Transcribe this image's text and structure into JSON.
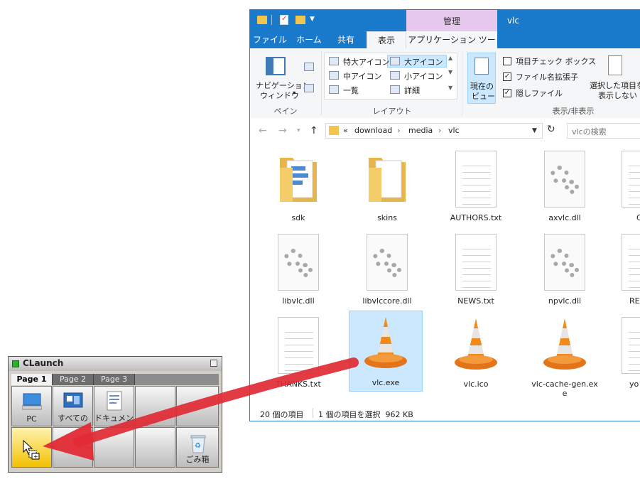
{
  "explorer": {
    "window_title": "vlc",
    "context_tab": "管理",
    "tabs": [
      "ファイル",
      "ホーム",
      "共有",
      "表示",
      "アプリケーション ツール"
    ],
    "active_tab": "表示",
    "ribbon": {
      "pane": {
        "nav_pane_line1": "ナビゲーション",
        "nav_pane_line2": "ウィンドウ",
        "group_label": "ペイン"
      },
      "layout": {
        "items": [
          "特大アイコン",
          "大アイコン",
          "中アイコン",
          "小アイコン",
          "一覧",
          "詳細"
        ],
        "selected": "大アイコン",
        "group_label": "レイアウト"
      },
      "current_view_line1": "現在の",
      "current_view_line2": "ビュー",
      "show_hide": {
        "checkbox_item_check": "項目チェック ボックス",
        "checkbox_extension": "ファイル名拡張子",
        "checkbox_hidden": "隠しファイル",
        "item_check_checked": false,
        "extension_checked": true,
        "hidden_checked": true,
        "hide_selected_line1": "選択した項目を",
        "hide_selected_line2": "表示しない",
        "group_label": "表示/非表示"
      }
    },
    "address": {
      "prefix": "«",
      "segments": [
        "download",
        "media",
        "vlc"
      ]
    },
    "search_placeholder": "vlcの検索",
    "files": [
      {
        "name": "sdk",
        "kind": "folder-docs"
      },
      {
        "name": "skins",
        "kind": "folder"
      },
      {
        "name": "AUTHORS.txt",
        "kind": "text"
      },
      {
        "name": "axvlc.dll",
        "kind": "dll"
      },
      {
        "name": "CO",
        "kind": "text"
      },
      {
        "name": "libvlc.dll",
        "kind": "dll"
      },
      {
        "name": "libvlccore.dll",
        "kind": "dll"
      },
      {
        "name": "NEWS.txt",
        "kind": "text"
      },
      {
        "name": "npvlc.dll",
        "kind": "dll"
      },
      {
        "name": "REA",
        "kind": "text"
      },
      {
        "name": "THANKS.txt",
        "kind": "text"
      },
      {
        "name": "vlc.exe",
        "kind": "cone",
        "selected": true
      },
      {
        "name": "vlc.ico",
        "kind": "cone"
      },
      {
        "name": "vlc-cache-gen.exe",
        "kind": "cone"
      },
      {
        "name": "yo",
        "kind": "text"
      }
    ],
    "status": {
      "item_count": "20 個の項目",
      "selection": "1 個の項目を選択  962 KB"
    }
  },
  "claunch": {
    "title": "CLaunch",
    "tabs": [
      "Page 1",
      "Page 2",
      "Page 3"
    ],
    "active_tab": "Page 1",
    "buttons": [
      {
        "label": "PC",
        "icon": "pc-icon"
      },
      {
        "label": "すべての",
        "icon": "control-panel-icon"
      },
      {
        "label": "ドキュメン",
        "icon": "document-icon"
      },
      {
        "label": "",
        "icon": ""
      },
      {
        "label": "",
        "icon": ""
      },
      {
        "label": "",
        "icon": "drop-target-icon",
        "highlighted": true
      },
      {
        "label": "",
        "icon": ""
      },
      {
        "label": "",
        "icon": ""
      },
      {
        "label": "",
        "icon": ""
      },
      {
        "label": "ごみ箱",
        "icon": "recycle-bin-icon"
      }
    ]
  },
  "colors": {
    "title_bar": "#1979ca",
    "context_tab": "#e7c8ef",
    "selection": "#cce8ff",
    "arrow": "#e12a34",
    "cone_orange": "#f08a1d"
  }
}
